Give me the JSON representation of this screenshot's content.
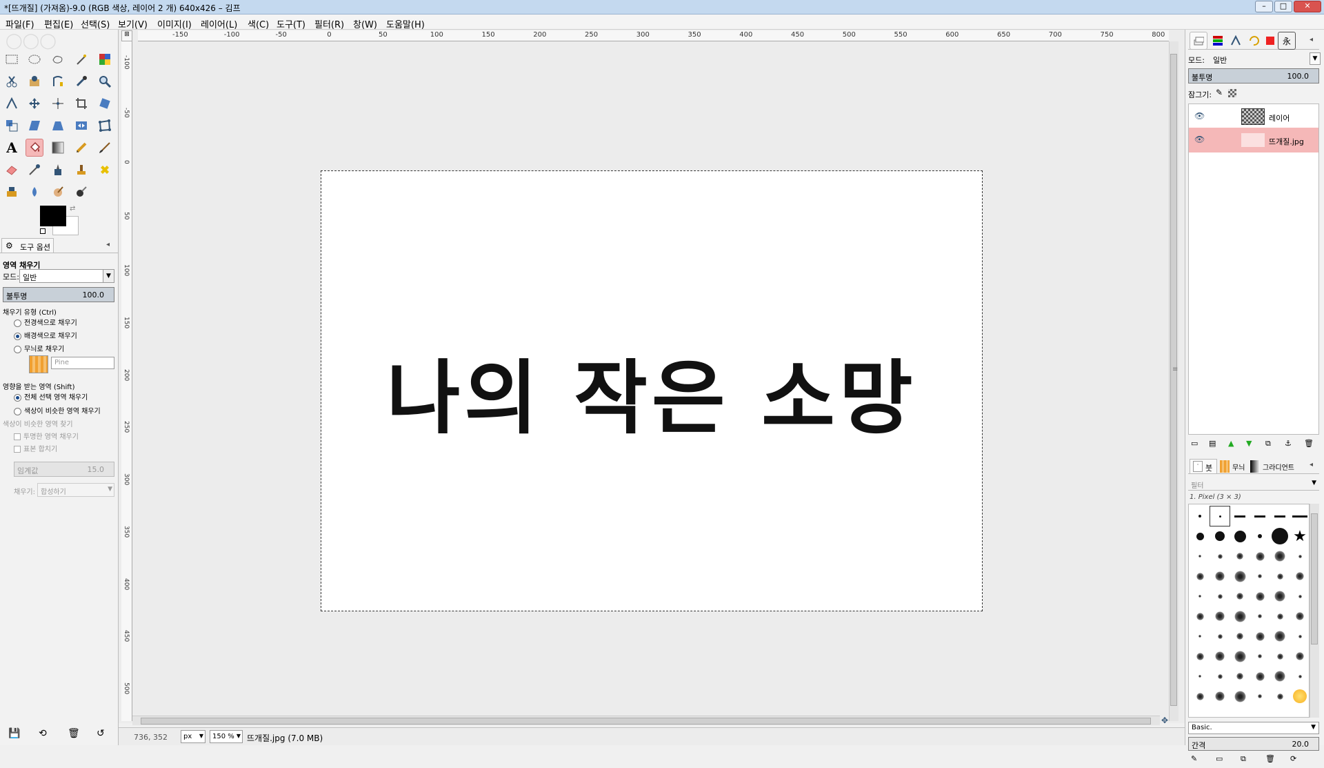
{
  "window": {
    "title": "*[뜨개질] (가져옴)-9.0 (RGB 색상, 레이어 2 개) 640x426 – 김프"
  },
  "menu": [
    "파일(F)",
    "편집(E)",
    "선택(S)",
    "보기(V)",
    "이미지(I)",
    "레이어(L)",
    "색(C)",
    "도구(T)",
    "필터(R)",
    "창(W)",
    "도움말(H)"
  ],
  "toolOptions": {
    "tabLabel": "도구 옵션",
    "toolName": "영역 채우기",
    "modeLabel": "모드:",
    "modeValue": "일반",
    "opacityLabel": "불투명",
    "opacityValue": "100.0",
    "fillTypeLabel": "채우기 유형 (Ctrl)",
    "fillTypes": [
      "전경색으로 채우기",
      "배경색으로 채우기",
      "무늬로 채우기"
    ],
    "patternName": "Pine",
    "affectedLabel": "영향을 받는 영역 (Shift)",
    "affected": [
      "전체 선택 영역 채우기",
      "색상이 비슷한 영역 채우기"
    ],
    "findSimilarLabel": "색상이 비슷한 영역 찾기",
    "transparentLabel": "투명한 영역 채우기",
    "sampleMergedLabel": "표본 합치기",
    "thresholdLabel": "임계값",
    "thresholdValue": "15.0",
    "fillByLabel": "채우기:",
    "fillByValue": "합성하기"
  },
  "ruler": {
    "hLabels": [
      "-150",
      "-100",
      "-50",
      "0",
      "50",
      "100",
      "150",
      "200",
      "250",
      "300",
      "350",
      "400",
      "450",
      "500",
      "550",
      "600",
      "650",
      "700",
      "750",
      "800"
    ],
    "vLabels": [
      "-100",
      "-50",
      "0",
      "50",
      "100",
      "150",
      "200",
      "250",
      "300",
      "350",
      "400",
      "450",
      "500"
    ]
  },
  "canvas": {
    "text": "나의 작은 소망"
  },
  "status": {
    "coords": "736, 352",
    "unit": "px",
    "zoom": "150 %",
    "file": "뜨개질.jpg (7.0 MB)"
  },
  "layers": {
    "modeLabel": "모드:",
    "modeValue": "일반",
    "opacityLabel": "불투명",
    "opacityValue": "100.0",
    "lockLabel": "잠그기:",
    "items": [
      {
        "name": "레이어"
      },
      {
        "name": "뜨개질.jpg"
      }
    ]
  },
  "brushes": {
    "tabs": [
      "붓",
      "무늬",
      "그라디언트"
    ],
    "filterPlaceholder": "필터",
    "selectedBrush": "1. Pixel (3 × 3)",
    "preset": "Basic.",
    "spacingLabel": "간격",
    "spacingValue": "20.0"
  },
  "colors": {
    "accentSelection": "#f5b8b8",
    "foreground": "#000000",
    "background": "#ffffff"
  }
}
